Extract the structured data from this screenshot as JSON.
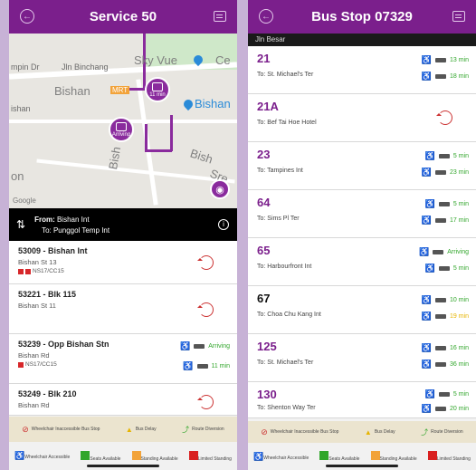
{
  "left": {
    "title": "Service 50",
    "map": {
      "labels": [
        "mpin Dr",
        "Jln Binchang",
        "Sky Vue",
        "Ce",
        "Bishan",
        "Bishan",
        "ishan",
        "Bish",
        "Bish",
        "Sre",
        "on",
        "Google"
      ],
      "pin1_text": "11 min",
      "pin2_text": "Arriving"
    },
    "route": {
      "from_label": "From:",
      "from": "Bishan Int",
      "to_label": "To:",
      "to": "Punggol Temp Int"
    },
    "stops": [
      {
        "name": "53009 - Bishan Int",
        "road": "Bishan St 13",
        "code": "NS17/CC15"
      },
      {
        "name": "53221 - Blk 115",
        "road": "Bishan St 11"
      },
      {
        "name": "53239 - Opp Bishan Stn",
        "road": "Bishan Rd",
        "code": "NS17/CC15",
        "arr1": "Arriving",
        "arr2": "11 min"
      },
      {
        "name": "53249 - Blk 210",
        "road": "Bishan Rd"
      }
    ],
    "legend1": [
      "Wheelchair Inaccessible Bus Stop",
      "Bus Delay",
      "Route Diversion"
    ],
    "legend2": [
      "Wheelchair Accessible",
      "Seats Available",
      "Standing Available",
      "Limited Standing"
    ]
  },
  "right": {
    "title": "Bus Stop 07329",
    "road": "Jln Besar",
    "services": [
      {
        "num": "21",
        "dest": "To: St. Michael's Ter",
        "t1": "13 min",
        "t2": "18 min"
      },
      {
        "num": "21A",
        "dest": "To: Bef Tai Hoe Hotel"
      },
      {
        "num": "23",
        "dest": "To: Tampines Int",
        "t1": "5 min",
        "t2": "23 min"
      },
      {
        "num": "64",
        "dest": "To: Sims Pl Ter",
        "t1": "5 min",
        "t2": "17 min"
      },
      {
        "num": "65",
        "dest": "To: Harbourfront Int",
        "t1": "Arriving",
        "t2": "5 min"
      },
      {
        "num": "67",
        "dest": "To: Choa Chu Kang Int",
        "t1": "10 min",
        "t2": "19 min"
      },
      {
        "num": "125",
        "dest": "To: St. Michael's Ter",
        "t1": "16 min",
        "t2": "36 min"
      },
      {
        "num": "130",
        "dest": "To: Shenton Way Ter",
        "t1": "5 min",
        "t2": "20 min"
      }
    ],
    "legend1": [
      "Wheelchair Inaccessible Bus Stop",
      "Bus Delay",
      "Route Diversion"
    ],
    "legend2": [
      "Wheelchair Accessible",
      "Seats Available",
      "Standing Available",
      "Limited Standing"
    ]
  },
  "icons": {
    "back": "back-circle-icon",
    "menu": "list-icon",
    "swap": "swap-icon",
    "info": "info-icon",
    "refresh": "refresh-icon",
    "wheelchair": "wheelchair-icon",
    "bus": "bus-icon"
  },
  "colors": {
    "brand": "#7b1f8c",
    "green": "#31a62b",
    "yellow": "#e6b400",
    "red": "#d92020"
  }
}
